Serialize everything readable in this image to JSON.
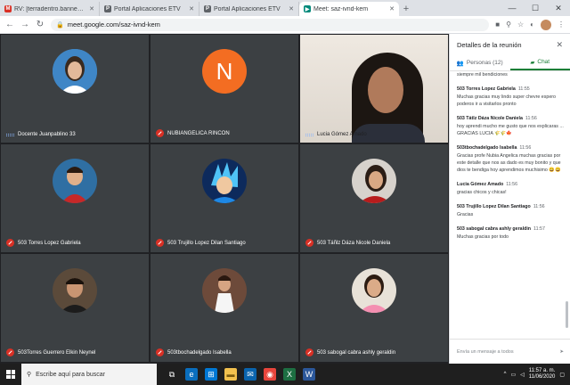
{
  "browser": {
    "tabs": [
      {
        "label": "RV: [terradentro.bannep.gov.co",
        "favicon": "M",
        "favicon_color": "#d93025",
        "active": false
      },
      {
        "label": "Portal Aplicaciones ETV",
        "favicon": "P",
        "favicon_color": "#5f6368",
        "active": false
      },
      {
        "label": "Portal Aplicaciones ETV",
        "favicon": "P",
        "favicon_color": "#5f6368",
        "active": false
      },
      {
        "label": "Meet: saz-ivnd-kem",
        "favicon": "▶",
        "favicon_color": "#00897b",
        "active": true
      }
    ],
    "new_tab": "+",
    "url": "meet.google.com/saz-ivnd-kem"
  },
  "tiles": [
    {
      "name": "Docente Juanpablino 33",
      "avatar": "photo-woman",
      "mic": "on"
    },
    {
      "name": "NUBIANGELICA RINCON",
      "avatar": "letter",
      "letter": "N",
      "mic": "off"
    },
    {
      "name": "Lucia Gómez Amado",
      "avatar": "camera",
      "mic": "on"
    },
    {
      "name": "503 Torres Lopez Gabriela",
      "avatar": "photo-boy",
      "mic": "off"
    },
    {
      "name": "503 Trujillo Lopez Dilan Santiago",
      "avatar": "photo-anime",
      "mic": "off"
    },
    {
      "name": "503 Táñlz Dáza Nicole Daniela",
      "avatar": "photo-girl",
      "mic": "off"
    },
    {
      "name": "503Torres Guerrero Elkin Neynel",
      "avatar": "photo-boy2",
      "mic": "off"
    },
    {
      "name": "503tbochadelgado Isabella",
      "avatar": "photo-girl2",
      "mic": "off"
    },
    {
      "name": "503 saboga‌l cabra ashly geraldin",
      "avatar": "photo-girl3",
      "mic": "off"
    }
  ],
  "panel": {
    "title": "Detalles de la reunión",
    "tab_people": "Personas (12)",
    "tab_chat": "Chat",
    "messages": [
      {
        "sender": "",
        "time": "",
        "text": "siempre mil bendiciones"
      },
      {
        "sender": "503 Torres Lopez Gabriela",
        "time": "11:55",
        "text": "Muchas gracias muy lindo super chevre espero poderos ir a visitarlos pronto"
      },
      {
        "sender": "503 Tátlz Dáza Nicole Daniela",
        "time": "11:56",
        "text": "hoy aprendi mucho me gusto que nos explicaras ... GRACIAS LUCIA 🌾🌾🍁"
      },
      {
        "sender": "503tbochadelgado Isabella",
        "time": "11:56",
        "text": "Gracias profe Nubia Angelica muchas gracias por este detalle que nos as dado es muy bonito y que dios te bendiga hoy aprendimos muchisimo 😀😀"
      },
      {
        "sender": "Lucia Gómez Amado",
        "time": "11:56",
        "text": "gracias chicos y chicas!"
      },
      {
        "sender": "503 Trujillo Lopez Dilan Santiago",
        "time": "11:56",
        "text": "Gracias"
      },
      {
        "sender": "503 sabogal cabra ashly geraldin",
        "time": "11:57",
        "text": "Muchas gracias por todo"
      }
    ],
    "input_placeholder": "Envía un mensaje a todos"
  },
  "taskbar": {
    "search_placeholder": "Escribe aquí para buscar",
    "time": "11:57 a. m.",
    "date": "11/06/2020"
  }
}
